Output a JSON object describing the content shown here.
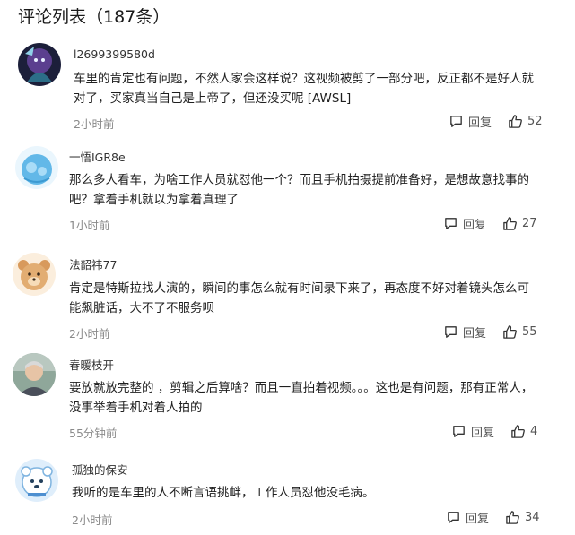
{
  "header": {
    "title": "评论列表（187条）"
  },
  "comments": [
    {
      "username": "l2699399580d",
      "text": "车里的肯定也有问题，不然人家会这样说？这视频被剪了一部分吧，反正都不是好人就对了，买家真当自己是上帝了，但还没买呢 [AWSL]",
      "time": "2小时前",
      "reply_label": "回复",
      "likes": "52"
    },
    {
      "username": "一悟IGR8e",
      "text": "那么多人看车，为啥工作人员就怼他一个？而且手机拍摄提前准备好，是想故意找事的吧？拿着手机就以为拿着真理了",
      "time": "1小时前",
      "reply_label": "回复",
      "likes": "27"
    },
    {
      "username": "法韶祎77",
      "text": "肯定是特斯拉找人演的，瞬间的事怎么就有时间录下来了，再态度不好对着镜头怎么可能飙脏话，大不了不服务呗",
      "time": "2小时前",
      "reply_label": "回复",
      "likes": "55"
    },
    {
      "username": "春暖枝开",
      "text": "要放就放完整的 ，剪辑之后算啥？而且一直拍着视频。。。这也是有问题，那有正常人，没事举着手机对着人拍的",
      "time": "55分钟前",
      "reply_label": "回复",
      "likes": "4"
    },
    {
      "username": "孤独的保安",
      "text": "我听的是车里的人不断言语挑衅，工作人员怼他没毛病。",
      "time": "2小时前",
      "reply_label": "回复",
      "likes": "34"
    }
  ]
}
